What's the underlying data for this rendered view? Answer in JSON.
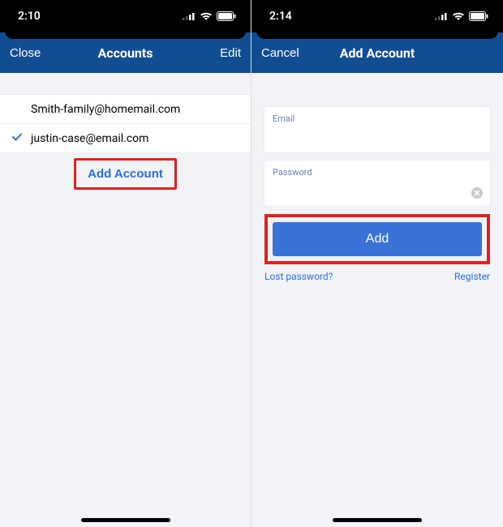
{
  "left": {
    "status": {
      "time": "2:10"
    },
    "nav": {
      "close": "Close",
      "title": "Accounts",
      "edit": "Edit"
    },
    "accounts": [
      {
        "email": "Smith-family@homemail.com",
        "selected": false
      },
      {
        "email": "justin-case@email.com",
        "selected": true
      }
    ],
    "add_account_label": "Add Account"
  },
  "right": {
    "status": {
      "time": "2:14"
    },
    "nav": {
      "cancel": "Cancel",
      "title": "Add Account"
    },
    "form": {
      "email_label": "Email",
      "password_label": "Password",
      "add_button": "Add",
      "lost_password": "Lost password?",
      "register": "Register"
    }
  }
}
